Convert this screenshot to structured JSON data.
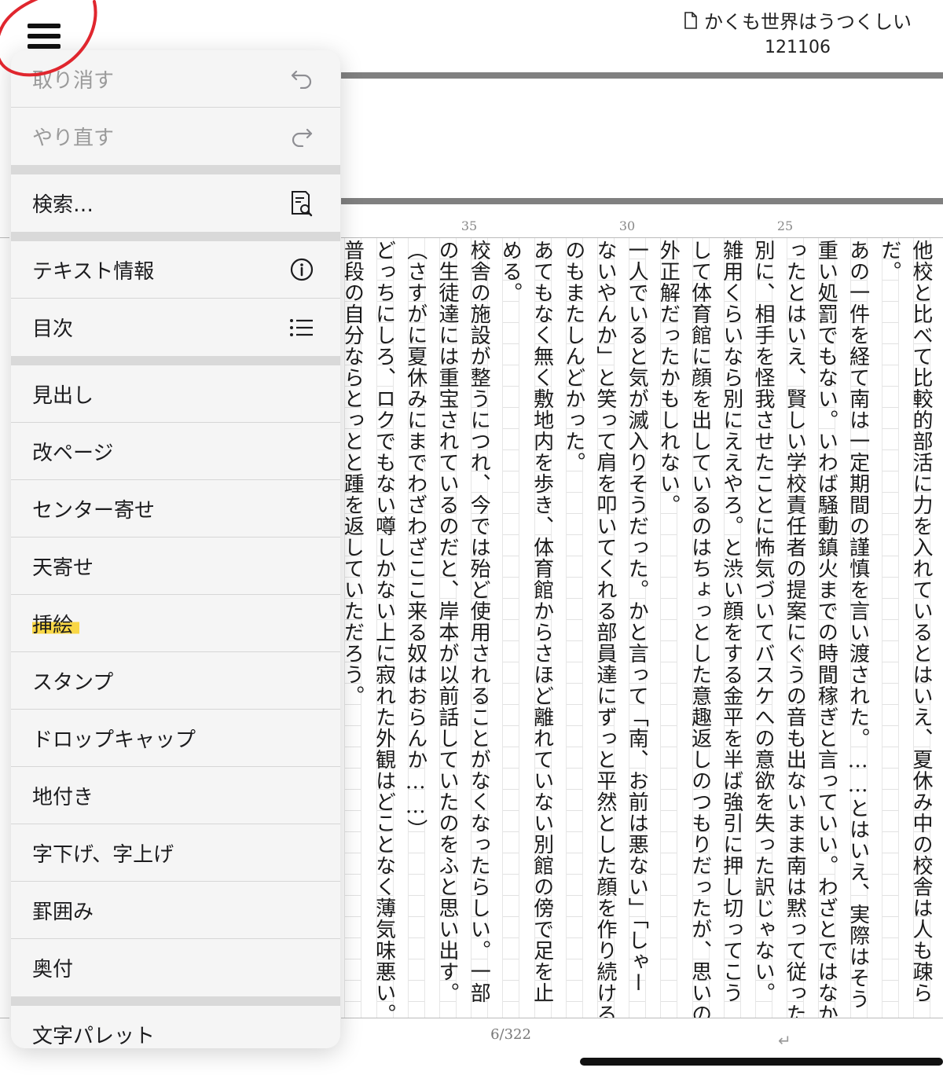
{
  "header": {
    "doc_title": "かくも世界はうつくしい",
    "doc_id": "121106"
  },
  "ruler": {
    "ticks": [
      "35",
      "30",
      "25"
    ]
  },
  "manuscript": {
    "columns": [
      "他校と比べて比較的部活に力を入れているとはいえ、夏休み中の校舎は人も疎ら",
      "だ。",
      "あの一件を経て南は一定期間の謹慎を言い渡された。……とはいえ、実際はそう",
      "重い処罰でもない。いわば騒動鎮火までの時間稼ぎと言っていい。わざとではなか",
      "ったとはいえ、賢しい学校責任者の提案にぐうの音も出ないまま南は黙って従った。",
      "別に、相手を怪我させたことに怖気づいてバスケへの意欲を失った訳じゃない。",
      "雑用くらいなら別にええやろ。と渋い顔をする金平を半ば強引に押し切ってこう",
      "して体育館に顔を出しているのはちょっとした意趣返しのつもりだったが、思いの",
      "外正解だったかもしれない。",
      "一人でいると気が滅入りそうだった。かと言って「南、お前は悪ない」「しゃー",
      "ないやんか」と笑って肩を叩いてくれる部員達にずっと平然とした顔を作り続ける",
      "のもまたしんどかった。",
      "あてもなく無く敷地内を歩き、体育館からさほど離れていない別館の傍で足を止",
      "める。",
      "校舎の施設が整うにつれ、今では殆ど使用されることがなくなったらしい。一部",
      "の生徒達には重宝されているのだと、岸本が以前話していたのをふと思い出す。",
      "（さすがに夏休みにまでわざわざここ来る奴はおらんか……）",
      "どっちにしろ、ロクでもない噂しかない上に寂れた外観はどことなく薄気味悪い。",
      "普段の自分ならとっとと踵を返していただろう。"
    ],
    "page_indicator": "6/322"
  },
  "menu": {
    "items": [
      {
        "label": "取り消す",
        "icon": "undo-icon",
        "disabled": true
      },
      {
        "label": "やり直す",
        "icon": "redo-icon",
        "disabled": true
      },
      {
        "label": "検索…",
        "icon": "search-document-icon"
      },
      {
        "label": "テキスト情報",
        "icon": "info-icon"
      },
      {
        "label": "目次",
        "icon": "list-icon"
      },
      {
        "label": "見出し"
      },
      {
        "label": "改ページ"
      },
      {
        "label": "センター寄せ"
      },
      {
        "label": "天寄せ"
      },
      {
        "label": "挿絵",
        "highlighted": true
      },
      {
        "label": "スタンプ"
      },
      {
        "label": "ドロップキャップ"
      },
      {
        "label": "地付き"
      },
      {
        "label": "字下げ、字上げ"
      },
      {
        "label": "罫囲み"
      },
      {
        "label": "奥付"
      },
      {
        "label": "文字パレット"
      }
    ]
  },
  "colors": {
    "annotation_circle": "#e0262e",
    "highlight": "#f8d12a"
  }
}
